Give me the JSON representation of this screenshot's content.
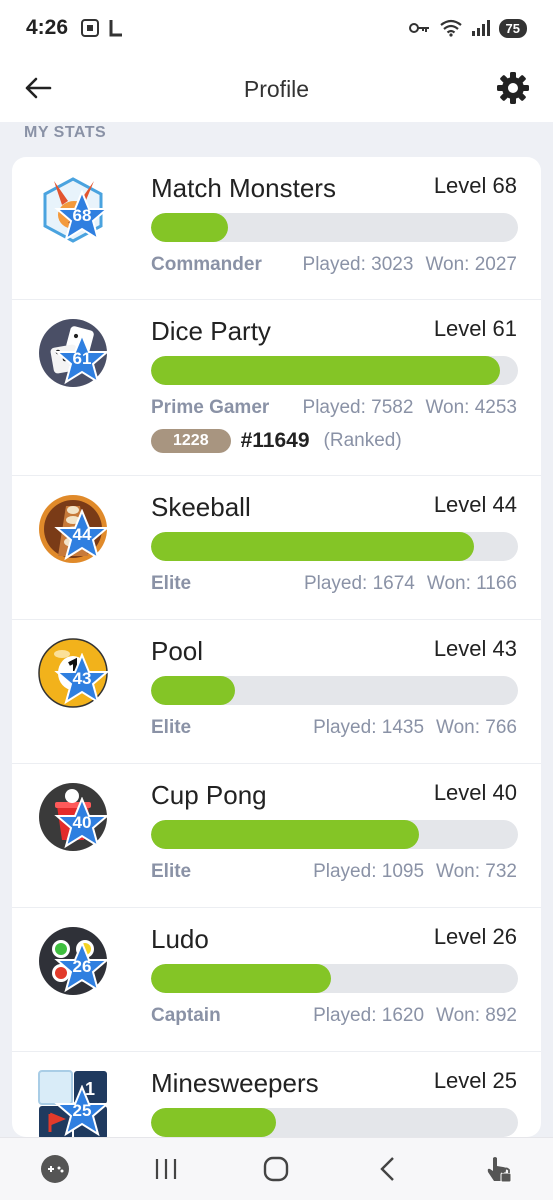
{
  "status_bar": {
    "time": "4:26",
    "battery": "75"
  },
  "header": {
    "title": "Profile"
  },
  "section": {
    "label": "MY STATS"
  },
  "games": [
    {
      "name": "Match Monsters",
      "level_text": "Level 68",
      "badge": "68",
      "progress": 0.21,
      "rank": "Commander",
      "played": "Played: 3023",
      "won": "Won: 2027",
      "icon": "match-monsters-icon",
      "color": "#f39a3d"
    },
    {
      "name": "Dice Party",
      "level_text": "Level 61",
      "badge": "61",
      "progress": 0.95,
      "rank": "Prime Gamer",
      "played": "Played: 7582",
      "won": "Won: 4253",
      "icon": "dice-party-icon",
      "color": "#4a4f66",
      "elo": "1228",
      "ranked_position": "#11649",
      "ranked_suffix": "(Ranked)"
    },
    {
      "name": "Skeeball",
      "level_text": "Level 44",
      "badge": "44",
      "progress": 0.88,
      "rank": "Elite",
      "played": "Played: 1674",
      "won": "Won: 1166",
      "icon": "skeeball-icon",
      "color": "#c9741f"
    },
    {
      "name": "Pool",
      "level_text": "Level 43",
      "badge": "43",
      "progress": 0.23,
      "rank": "Elite",
      "played": "Played: 1435",
      "won": "Won: 766",
      "icon": "pool-ball-icon",
      "color": "#f2b21b"
    },
    {
      "name": "Cup Pong",
      "level_text": "Level 40",
      "badge": "40",
      "progress": 0.73,
      "rank": "Elite",
      "played": "Played: 1095",
      "won": "Won: 732",
      "icon": "cup-pong-icon",
      "color": "#3a3a3a"
    },
    {
      "name": "Ludo",
      "level_text": "Level 26",
      "badge": "26",
      "progress": 0.49,
      "rank": "Captain",
      "played": "Played: 1620",
      "won": "Won: 892",
      "icon": "ludo-icon",
      "color": "#2f3138"
    },
    {
      "name": "Minesweepers",
      "level_text": "Level 25",
      "badge": "25",
      "progress": 0.34,
      "icon": "minesweepers-icon",
      "color": "#1f3a5f"
    }
  ],
  "colors": {
    "progress_fill": "#84c526",
    "progress_track": "#e4e6ea",
    "badge_star": "#2f7fe0",
    "muted_text": "#8a92a6",
    "elo_badge": "#a89580"
  },
  "nav": {
    "items": [
      "game-launcher-icon",
      "recent-apps-icon",
      "home-icon",
      "back-icon",
      "touch-lock-icon"
    ]
  }
}
